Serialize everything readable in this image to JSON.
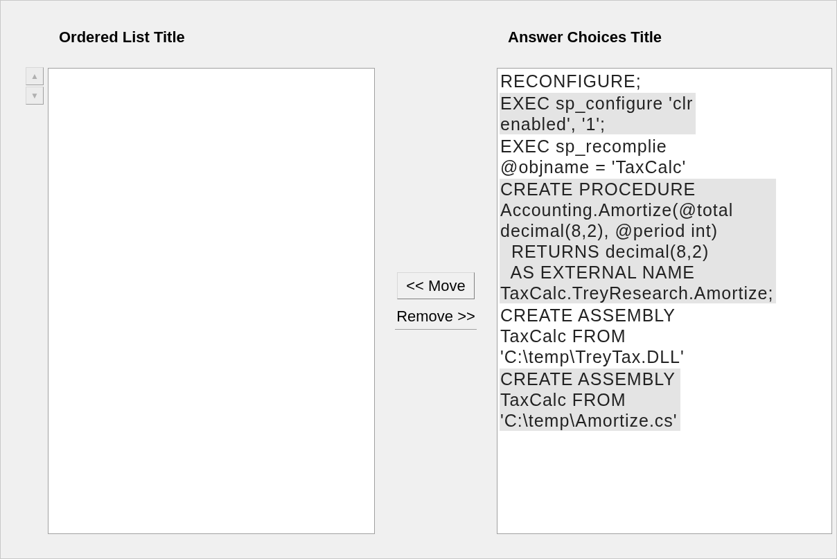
{
  "ordered_list": {
    "title": "Ordered List Title",
    "up_button": "▲",
    "down_button": "▼"
  },
  "buttons": [
    {
      "label": "<< Move"
    },
    {
      "label": "Remove >>"
    }
  ],
  "answer_choices": {
    "title": "Answer Choices Title",
    "items": [
      {
        "text": "RECONFIGURE;"
      },
      {
        "text": "EXEC sp_configure 'clr\nenabled', '1';"
      },
      {
        "text": "EXEC sp_recomplie\n@objname = 'TaxCalc'"
      },
      {
        "text": "CREATE PROCEDURE\nAccounting.Amortize(@total\ndecimal(8,2), @period int)\n  RETURNS decimal(8,2)\n  AS EXTERNAL NAME\nTaxCalc.TreyResearch.Amortize;"
      },
      {
        "text": "CREATE ASSEMBLY\nTaxCalc FROM\n'C:\\temp\\TreyTax.DLL'"
      },
      {
        "text": "CREATE ASSEMBLY\nTaxCalc FROM\n'C:\\temp\\Amortize.cs'"
      }
    ]
  }
}
